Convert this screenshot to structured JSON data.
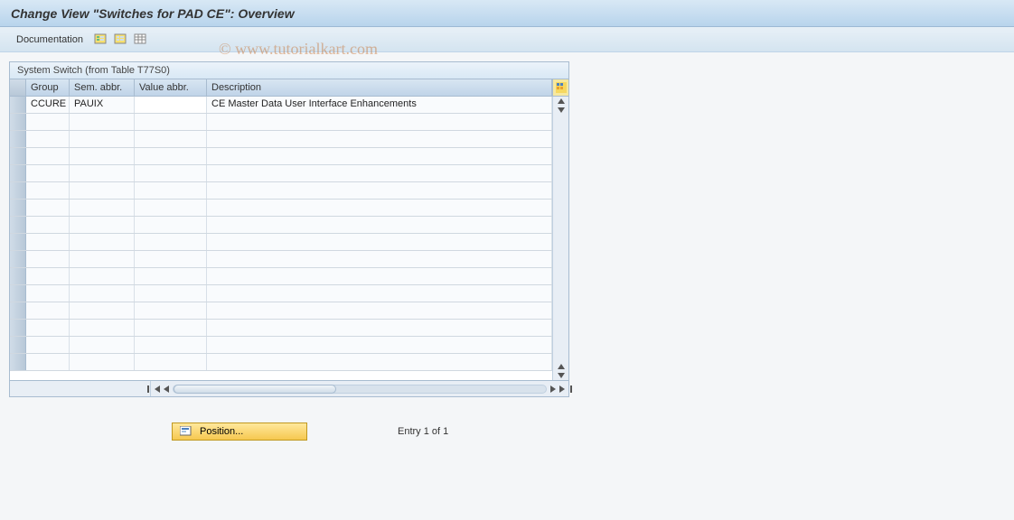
{
  "title": "Change View \"Switches for PAD CE\": Overview",
  "toolbar": {
    "documentation_label": "Documentation"
  },
  "table": {
    "title": "System Switch (from Table T77S0)",
    "columns": {
      "group": "Group",
      "sem": "Sem. abbr.",
      "val": "Value abbr.",
      "desc": "Description"
    },
    "rows": [
      {
        "group": "CCURE",
        "sem": "PAUIX",
        "val": "",
        "desc": "CE Master Data User Interface Enhancements"
      }
    ],
    "empty_row_count": 15
  },
  "footer": {
    "position_label": "Position...",
    "entry_text": "Entry 1 of 1"
  },
  "watermark": "© www.tutorialkart.com"
}
